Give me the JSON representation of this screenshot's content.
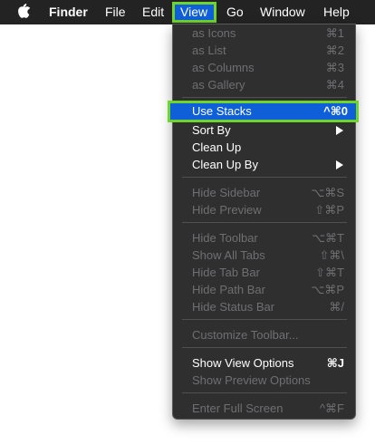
{
  "menubar": {
    "apple_icon": "apple-logo-icon",
    "items": [
      "Finder",
      "File",
      "Edit",
      "View",
      "Go",
      "Window",
      "Help"
    ],
    "highlight_color": "#0f5fd8",
    "annotation_color": "#6fd42b"
  },
  "view_menu": {
    "groups": [
      [
        {
          "label": "as Icons",
          "shortcut": "⌘1",
          "enabled": false
        },
        {
          "label": "as List",
          "shortcut": "⌘2",
          "enabled": false
        },
        {
          "label": "as Columns",
          "shortcut": "⌘3",
          "enabled": false
        },
        {
          "label": "as Gallery",
          "shortcut": "⌘4",
          "enabled": false
        }
      ],
      [
        {
          "label": "Use Stacks",
          "shortcut": "^⌘0",
          "enabled": true,
          "highlighted": true
        },
        {
          "label": "Sort By",
          "submenu": true,
          "enabled": true
        },
        {
          "label": "Clean Up",
          "enabled": true
        },
        {
          "label": "Clean Up By",
          "submenu": true,
          "enabled": true
        }
      ],
      [
        {
          "label": "Hide Sidebar",
          "shortcut": "⌥⌘S",
          "enabled": false
        },
        {
          "label": "Hide Preview",
          "shortcut": "⇧⌘P",
          "enabled": false
        }
      ],
      [
        {
          "label": "Hide Toolbar",
          "shortcut": "⌥⌘T",
          "enabled": false
        },
        {
          "label": "Show All Tabs",
          "shortcut": "⇧⌘\\",
          "enabled": false
        },
        {
          "label": "Hide Tab Bar",
          "shortcut": "⇧⌘T",
          "enabled": false
        },
        {
          "label": "Hide Path Bar",
          "shortcut": "⌥⌘P",
          "enabled": false
        },
        {
          "label": "Hide Status Bar",
          "shortcut": "⌘/",
          "enabled": false
        }
      ],
      [
        {
          "label": "Customize Toolbar...",
          "enabled": false
        }
      ],
      [
        {
          "label": "Show View Options",
          "shortcut": "⌘J",
          "enabled": true
        },
        {
          "label": "Show Preview Options",
          "enabled": false
        }
      ],
      [
        {
          "label": "Enter Full Screen",
          "shortcut": "^⌘F",
          "enabled": false
        }
      ]
    ]
  }
}
